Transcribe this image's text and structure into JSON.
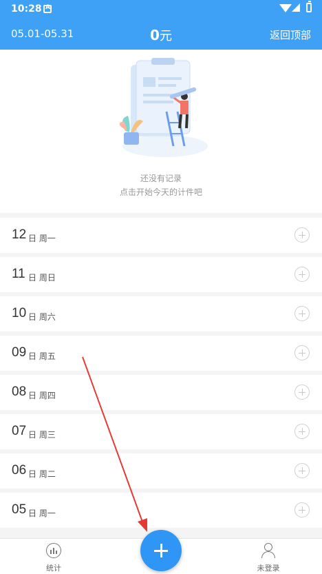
{
  "status_bar": {
    "time": "10:28"
  },
  "header": {
    "range": "05.01-05.31",
    "amount_value": "0",
    "amount_unit": "元",
    "back_top": "返回顶部"
  },
  "empty_state": {
    "line1": "还没有记录",
    "line2": "点击开始今天的计件吧"
  },
  "days": [
    {
      "day": "12",
      "suffix": "日 周一"
    },
    {
      "day": "11",
      "suffix": "日 周日"
    },
    {
      "day": "10",
      "suffix": "日 周六"
    },
    {
      "day": "09",
      "suffix": "日 周五"
    },
    {
      "day": "08",
      "suffix": "日 周四"
    },
    {
      "day": "07",
      "suffix": "日 周三"
    },
    {
      "day": "06",
      "suffix": "日 周二"
    },
    {
      "day": "05",
      "suffix": "日 周一"
    }
  ],
  "bottom_nav": {
    "stats": "统计",
    "login": "未登录"
  },
  "colors": {
    "primary": "#3ea1f5",
    "fab": "#2f96f5",
    "annotation_arrow": "#e53935"
  },
  "icons": [
    "a-notification-icon",
    "wifi-icon",
    "signal-icon",
    "battery-icon",
    "add-circle-icon",
    "stats-icon",
    "user-icon",
    "plus-icon"
  ]
}
